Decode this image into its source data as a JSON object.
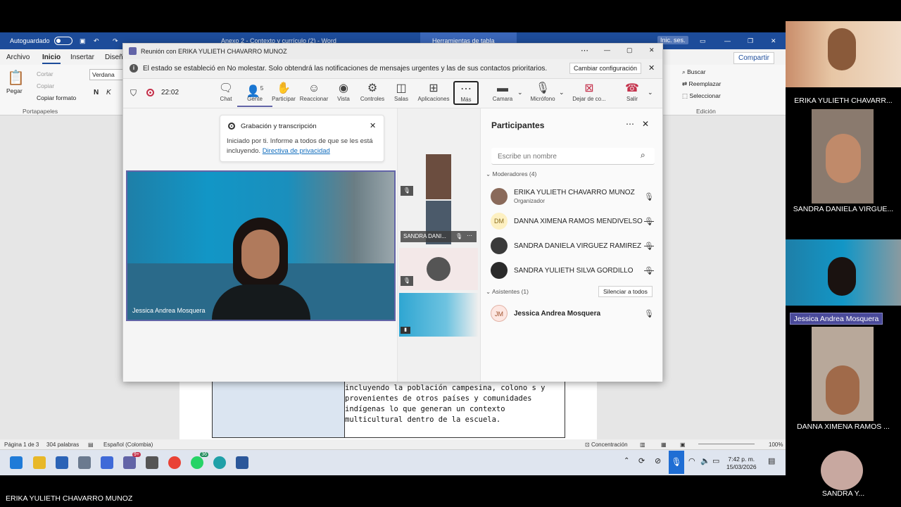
{
  "word": {
    "autosave": "Autoguardado",
    "doc_title": "Anexo 2 - Contexto y currículo (2) - Word",
    "table_tools": "Herramientas de tabla",
    "signin": "Inic. ses.",
    "tabs": [
      "Archivo",
      "Inicio",
      "Insertar",
      "Diseñ"
    ],
    "share": "Compartir",
    "clipboard": {
      "paste": "Pegar",
      "cut": "Cortar",
      "copy": "Copiar",
      "format": "Copiar formato",
      "group": "Portapapeles"
    },
    "font": "Verdana",
    "editing": {
      "find": "Buscar",
      "replace": "Reemplazar",
      "select": "Seleccionar",
      "group": "Edición"
    },
    "doc_text": "incluyendo la población campesina, colono s y provenientes de otros países y comunidades indígenas lo que generan un contexto multicultural dentro de la escuela.",
    "status": {
      "page": "Página 1 de 3",
      "words": "304 palabras",
      "lang": "Español (Colombia)",
      "focus": "Concentración",
      "zoom": "100%"
    }
  },
  "taskbar": {
    "time": "7:42 p. m.",
    "date": "15/03/2026",
    "badge_teams": "9+",
    "badge_whatsapp": "36"
  },
  "teams": {
    "window_title": "Reunión con ERIKA YULIETH CHAVARRO MUNOZ",
    "banner_text": "El estado se estableció en No molestar. Solo obtendrá las notificaciones de mensajes urgentes y las de sus contactos prioritarios.",
    "banner_button": "Cambiar configuración",
    "timer": "22:02",
    "tools": {
      "chat": "Chat",
      "people": "Gente",
      "people_count": "5",
      "raise": "Participar",
      "react": "Reaccionar",
      "view": "Vista",
      "controls": "Controles",
      "rooms": "Salas",
      "apps": "Aplicaciones",
      "more": "Más",
      "camera": "Camara",
      "mic": "Micrófono",
      "share": "Dejar de co...",
      "leave": "Salir"
    },
    "recording": {
      "title": "Grabación y transcripción",
      "text": "Iniciado por ti. Informe a todos de que se les está incluyendo. ",
      "link": "Directiva de privacidad"
    },
    "main_video_name": "Jessica Andrea Mosquera",
    "mid_tile_label": "SANDRA DANI...",
    "panel": {
      "title": "Participantes",
      "search_placeholder": "Escribe un nombre",
      "moderators_header": "Moderadores (4)",
      "attendees_header": "Asistentes (1)",
      "mute_all": "Silenciar a todos",
      "moderators": [
        {
          "name": "ERIKA YULIETH CHAVARRO MUNOZ",
          "role": "Organizador",
          "initials": ""
        },
        {
          "name": "DANNA XIMENA RAMOS MENDIVELSO",
          "role": "",
          "initials": "DM"
        },
        {
          "name": "SANDRA DANIELA VIRGUEZ RAMIREZ",
          "role": "",
          "initials": ""
        },
        {
          "name": "SANDRA YULIETH SILVA GORDILLO",
          "role": "",
          "initials": ""
        }
      ],
      "attendees": [
        {
          "name": "Jessica Andrea Mosquera",
          "initials": "JM"
        }
      ]
    }
  },
  "gallery": [
    {
      "name": "ERIKA YULIETH CHAVARR..."
    },
    {
      "name": "SANDRA DANIELA VIRGUE..."
    },
    {
      "name": "Jessica Andrea Mosquera"
    },
    {
      "name": "DANNA XIMENA RAMOS ..."
    },
    {
      "name": "SANDRA Y..."
    }
  ],
  "footer_name": "ERIKA YULIETH CHAVARRO MUNOZ",
  "colors": {
    "word_blue": "#1d4c9a",
    "teams_purple": "#6264a7",
    "leave_red": "#c4314b",
    "accent_blue": "#0f6cbd"
  }
}
